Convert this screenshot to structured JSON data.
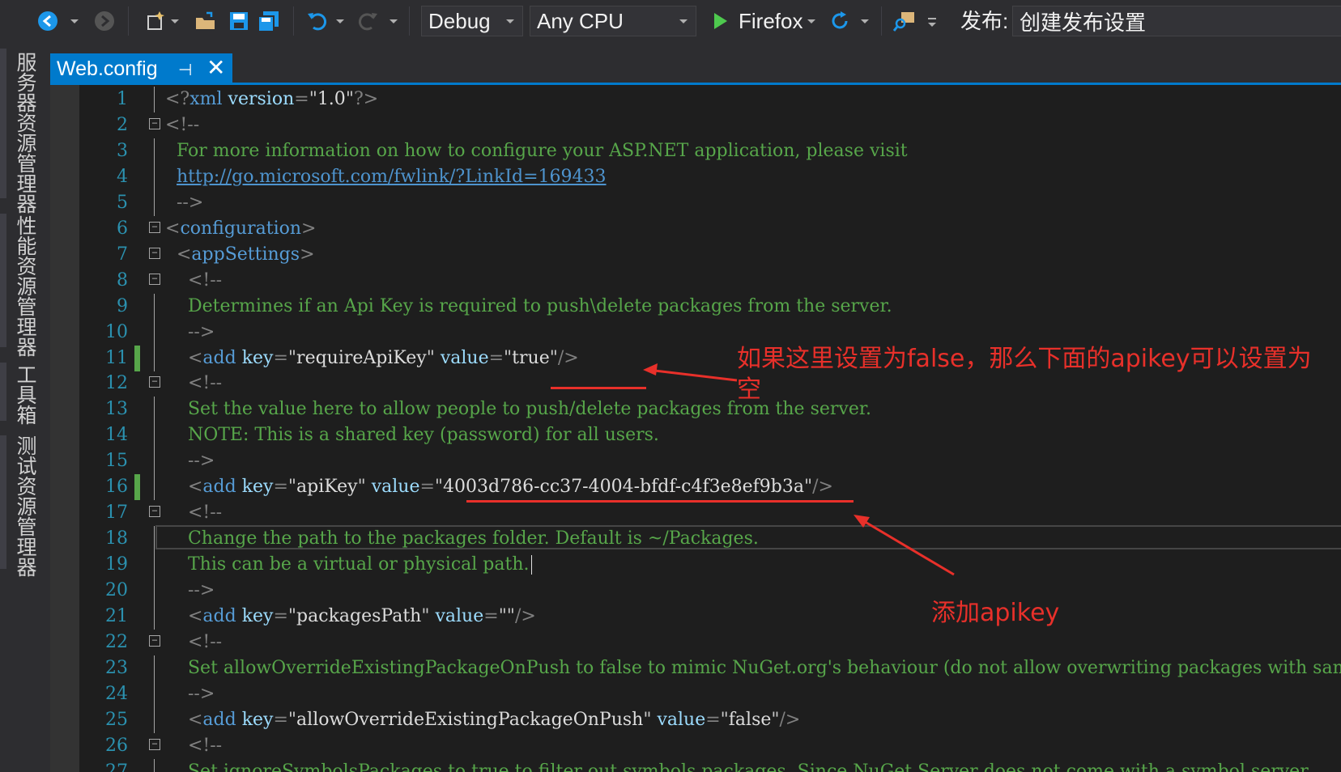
{
  "toolbar": {
    "config_value": "Debug",
    "platform_value": "Any CPU",
    "run_target": "Firefox",
    "publish_label": "发布:",
    "publish_value": "创建发布设置"
  },
  "side_tabs": [
    {
      "label": "服务器资源管理器"
    },
    {
      "label": "性能资源管理器"
    },
    {
      "label": "工具箱"
    },
    {
      "label": "测试资源管理器"
    }
  ],
  "tab": {
    "title": "Web.config",
    "pin": "⊣",
    "close": "✕"
  },
  "editor": {
    "lines": [
      {
        "n": "1",
        "segs": [
          [
            "c-br",
            "<?"
          ],
          [
            "c-tag",
            "xml"
          ],
          [
            "c-attr",
            " version"
          ],
          [
            "c-br",
            "="
          ],
          [
            "c-q",
            "\""
          ],
          [
            "c-valw",
            "1.0"
          ],
          [
            "c-q",
            "\""
          ],
          [
            "c-br",
            "?>"
          ]
        ]
      },
      {
        "n": "2",
        "segs": [
          [
            "c-br",
            "<!--"
          ]
        ]
      },
      {
        "n": "3",
        "segs": [
          [
            "c-com",
            "  For more information on how to configure your ASP.NET application, please visit"
          ]
        ]
      },
      {
        "n": "4",
        "segs": [
          [
            "c-com",
            "  "
          ],
          [
            "c-link",
            "http://go.microsoft.com/fwlink/?LinkId=169433"
          ]
        ]
      },
      {
        "n": "5",
        "segs": [
          [
            "c-br",
            "  -->"
          ]
        ]
      },
      {
        "n": "6",
        "segs": [
          [
            "c-br",
            "<"
          ],
          [
            "c-tag",
            "configuration"
          ],
          [
            "c-br",
            ">"
          ]
        ]
      },
      {
        "n": "7",
        "segs": [
          [
            "c-br",
            "  <"
          ],
          [
            "c-tag",
            "appSettings"
          ],
          [
            "c-br",
            ">"
          ]
        ]
      },
      {
        "n": "8",
        "segs": [
          [
            "c-br",
            "    <!--"
          ]
        ]
      },
      {
        "n": "9",
        "segs": [
          [
            "c-com",
            "    Determines if an Api Key is required to push\\delete packages from the server."
          ]
        ]
      },
      {
        "n": "10",
        "segs": [
          [
            "c-br",
            "    -->"
          ]
        ]
      },
      {
        "n": "11",
        "segs": [
          [
            "c-br",
            "    <"
          ],
          [
            "c-tag",
            "add"
          ],
          [
            "c-attr",
            " key"
          ],
          [
            "c-br",
            "="
          ],
          [
            "c-q",
            "\""
          ],
          [
            "c-valw",
            "requireApiKey"
          ],
          [
            "c-q",
            "\""
          ],
          [
            "c-attr",
            " value"
          ],
          [
            "c-br",
            "="
          ],
          [
            "c-q",
            "\""
          ],
          [
            "c-valw",
            "true"
          ],
          [
            "c-q",
            "\""
          ],
          [
            "c-br",
            "/>"
          ]
        ]
      },
      {
        "n": "12",
        "segs": [
          [
            "c-br",
            "    <!--"
          ]
        ]
      },
      {
        "n": "13",
        "segs": [
          [
            "c-com",
            "    Set the value here to allow people to push/delete packages from the server."
          ]
        ]
      },
      {
        "n": "14",
        "segs": [
          [
            "c-com",
            "    NOTE: This is a shared key (password) for all users."
          ]
        ]
      },
      {
        "n": "15",
        "segs": [
          [
            "c-br",
            "    -->"
          ]
        ]
      },
      {
        "n": "16",
        "segs": [
          [
            "c-br",
            "    <"
          ],
          [
            "c-tag",
            "add"
          ],
          [
            "c-attr",
            " key"
          ],
          [
            "c-br",
            "="
          ],
          [
            "c-q",
            "\""
          ],
          [
            "c-valw",
            "apiKey"
          ],
          [
            "c-q",
            "\""
          ],
          [
            "c-attr",
            " value"
          ],
          [
            "c-br",
            "="
          ],
          [
            "c-q",
            "\""
          ],
          [
            "c-valw",
            "4003d786-cc37-4004-bfdf-c4f3e8ef9b3a"
          ],
          [
            "c-q",
            "\""
          ],
          [
            "c-br",
            "/>"
          ]
        ]
      },
      {
        "n": "17",
        "segs": [
          [
            "c-br",
            "    <!--"
          ]
        ]
      },
      {
        "n": "18",
        "segs": [
          [
            "c-com",
            "    Change the path to the packages folder. Default is ~/Packages."
          ]
        ]
      },
      {
        "n": "19",
        "segs": [
          [
            "c-com",
            "    This can be a virtual or physical path."
          ]
        ]
      },
      {
        "n": "20",
        "segs": [
          [
            "c-br",
            "    -->"
          ]
        ]
      },
      {
        "n": "21",
        "segs": [
          [
            "c-br",
            "    <"
          ],
          [
            "c-tag",
            "add"
          ],
          [
            "c-attr",
            " key"
          ],
          [
            "c-br",
            "="
          ],
          [
            "c-q",
            "\""
          ],
          [
            "c-valw",
            "packagesPath"
          ],
          [
            "c-q",
            "\""
          ],
          [
            "c-attr",
            " value"
          ],
          [
            "c-br",
            "="
          ],
          [
            "c-q",
            "\"\""
          ],
          [
            "c-br",
            "/>"
          ]
        ]
      },
      {
        "n": "22",
        "segs": [
          [
            "c-br",
            "    <!--"
          ]
        ]
      },
      {
        "n": "23",
        "segs": [
          [
            "c-com",
            "    Set allowOverrideExistingPackageOnPush to false to mimic NuGet.org's behaviour (do not allow overwriting packages with same id + version)."
          ]
        ]
      },
      {
        "n": "24",
        "segs": [
          [
            "c-br",
            "    -->"
          ]
        ]
      },
      {
        "n": "25",
        "segs": [
          [
            "c-br",
            "    <"
          ],
          [
            "c-tag",
            "add"
          ],
          [
            "c-attr",
            " key"
          ],
          [
            "c-br",
            "="
          ],
          [
            "c-q",
            "\""
          ],
          [
            "c-valw",
            "allowOverrideExistingPackageOnPush"
          ],
          [
            "c-q",
            "\""
          ],
          [
            "c-attr",
            " value"
          ],
          [
            "c-br",
            "="
          ],
          [
            "c-q",
            "\""
          ],
          [
            "c-valw",
            "false"
          ],
          [
            "c-q",
            "\""
          ],
          [
            "c-br",
            "/>"
          ]
        ]
      },
      {
        "n": "26",
        "segs": [
          [
            "c-br",
            "    <!--"
          ]
        ]
      },
      {
        "n": "27",
        "segs": [
          [
            "c-com",
            "    Set ignoreSymbolsPackages to true to filter out symbols packages. Since NuGet.Server does not come with a symbol server,"
          ]
        ]
      }
    ]
  },
  "annotations": {
    "note_top_line1": "如果这里设置为false，那么下面的apikey可以设置为",
    "note_top_line2": "空",
    "note_bottom": "添加apikey"
  },
  "colors": {
    "accent": "#007acc",
    "annotation_red": "#e8302a",
    "comment_green": "#57a64a",
    "line_number": "#2b91af"
  }
}
